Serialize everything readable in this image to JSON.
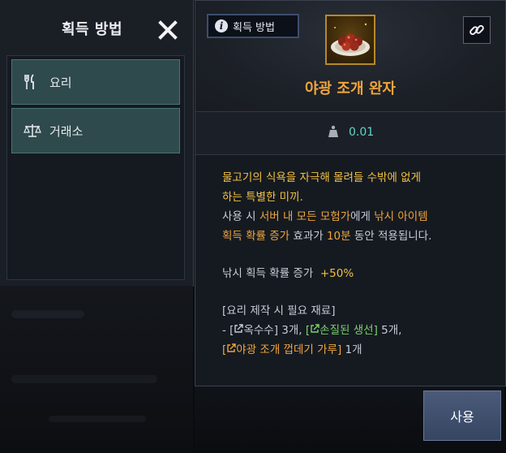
{
  "acquisition_panel": {
    "title": "획득 방법",
    "close_icon": "close-icon",
    "sources": [
      {
        "label": "요리",
        "icon": "fork-knife-icon"
      },
      {
        "label": "거래소",
        "icon": "scale-icon"
      }
    ]
  },
  "item_card": {
    "badge_label": "획득 방법",
    "badge_icon": "info-icon",
    "item_image": "grilled-clam-dish-icon",
    "link_icon": "link-icon",
    "name": "야광 조개 완자",
    "weight": "0.01",
    "weight_icon": "weight-icon",
    "description": {
      "line1": "물고기의 식욕을 자극해 몰려들 수밖에 없게",
      "line2": "하는 특별한 미끼.",
      "line3_a": "사용 시 ",
      "line3_b": "서버 내 모든 모험가",
      "line3_c": "에게 ",
      "line3_d": "낚시 아이템",
      "line4_a": "획득 확률 증가",
      "line4_b": " 효과가 ",
      "line4_c": "10분",
      "line4_d": " 동안 적용됩니다."
    },
    "effect": {
      "label": "낚시 획득 확률 증가",
      "value": "+50%"
    },
    "materials_title": "[요리 제작 시 필요 재료]",
    "materials": {
      "prefix": "- ",
      "m1_name": "옥수수",
      "m1_count": " 3개, ",
      "m2_name": "손질된 생선",
      "m2_count": " 5개,",
      "m3_name": "야광 조개 껍데기 가루",
      "m3_count": " 1개"
    }
  },
  "use_button_label": "사용",
  "colors": {
    "item_name": "#f0a53c",
    "highlight_yellow": "#f2c041",
    "weight_value": "#5fd6c7",
    "material_green": "#7bd16c",
    "material_blue": "#6db8f0",
    "source_item_bg": "#2e4a4d"
  }
}
